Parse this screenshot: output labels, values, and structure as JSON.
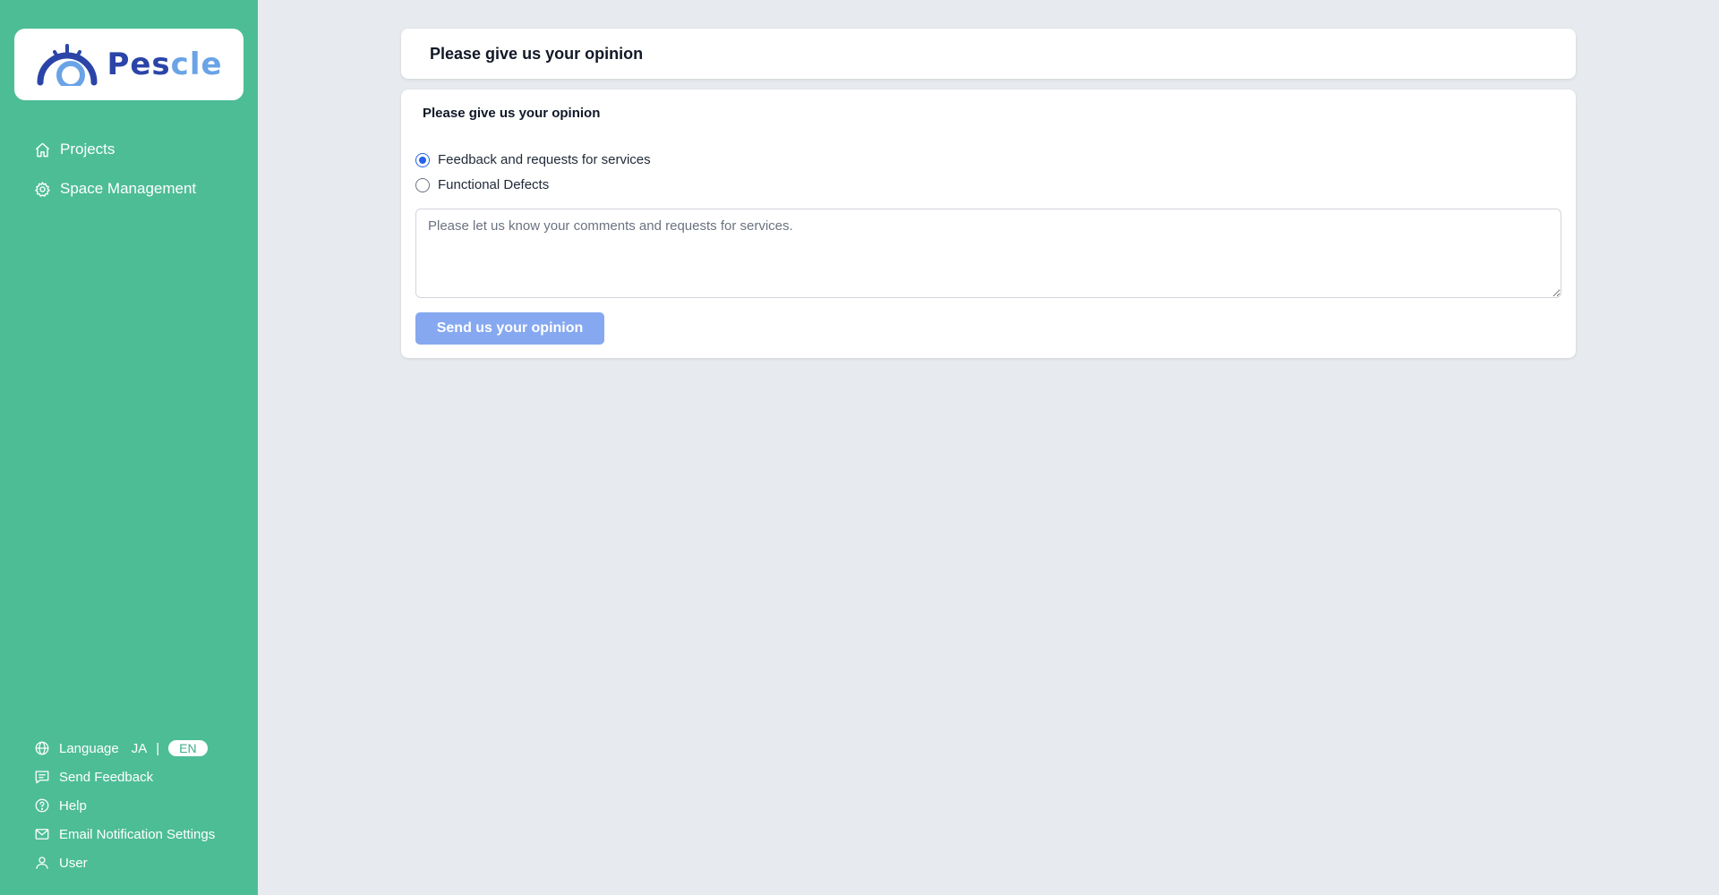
{
  "brand": {
    "name_dark": "Pes",
    "name_light": "cle",
    "colors": {
      "dark": "#2b44a8",
      "light": "#6aa3e6"
    }
  },
  "sidebar": {
    "background": "#4dbd96",
    "nav": [
      {
        "label": "Projects",
        "icon": "home-icon"
      },
      {
        "label": "Space Management",
        "icon": "gear-icon"
      }
    ],
    "language": {
      "label": "Language",
      "options": [
        "JA",
        "EN"
      ],
      "separator": "|",
      "selected": "EN"
    },
    "bottom_items": [
      {
        "label": "Send Feedback",
        "icon": "chat-icon"
      },
      {
        "label": "Help",
        "icon": "help-icon"
      },
      {
        "label": "Email Notification Settings",
        "icon": "mail-icon"
      },
      {
        "label": "User",
        "icon": "user-icon"
      }
    ]
  },
  "main": {
    "header_title": "Please give us your opinion",
    "form": {
      "title": "Please give us your opinion",
      "options": [
        {
          "label": "Feedback and requests for services",
          "checked": true
        },
        {
          "label": "Functional Defects",
          "checked": false
        }
      ],
      "textarea_placeholder": "Please let us know your comments and requests for services.",
      "submit_label": "Send us your opinion",
      "accent_color": "#2563eb",
      "button_color": "#86a8f0"
    }
  }
}
